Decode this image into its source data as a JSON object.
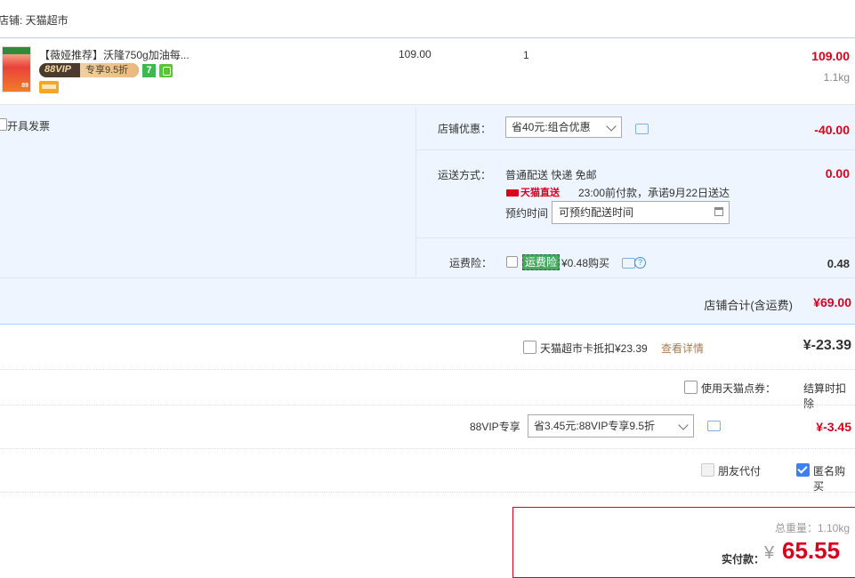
{
  "store": {
    "label": "店铺: 天猫超市"
  },
  "item": {
    "title": "【薇娅推荐】沃隆750g加油每...",
    "vip_left": "88VIP",
    "vip_right": "专享9.5折",
    "icon_7": "7",
    "thumb_price": "89",
    "unit_price": "109.00",
    "quantity": "1",
    "subtotal": "109.00",
    "weight": "1.1kg"
  },
  "invoice": {
    "label": "开具发票"
  },
  "shop_discount": {
    "label": "店铺优惠：",
    "selected": "省40元:组合优惠",
    "amount": "-40.00"
  },
  "shipping": {
    "label": "运送方式：",
    "method": "普通配送 快递 免邮",
    "amount": "0.00",
    "logo_text": "天猫直送",
    "promise": "23:00前付款，承诺9月22日送达",
    "reserve_label": "预约时间",
    "reserve_placeholder": "可预约配送时间"
  },
  "insurance": {
    "label": "运费险：",
    "badge": "运费险",
    "price": "¥0.48购买",
    "amount": "0.48"
  },
  "store_total": {
    "label": "店铺合计(含运费)",
    "amount": "¥69.00"
  },
  "tmall_card": {
    "label": "天猫超市卡抵扣¥23.39",
    "link": "查看详情",
    "amount": "¥-23.39"
  },
  "points": {
    "label": "使用天猫点券：",
    "note": "结算时扣除"
  },
  "vip88": {
    "label": "88VIP专享",
    "selected": "省3.45元:88VIP专享9.5折",
    "amount": "¥-3.45"
  },
  "options": {
    "friend_pay": "朋友代付",
    "anonymous": "匿名购买"
  },
  "summary": {
    "weight": "总重量：1.10kg",
    "pay_label": "实付款：",
    "currency": "¥",
    "amount": "65.55"
  }
}
